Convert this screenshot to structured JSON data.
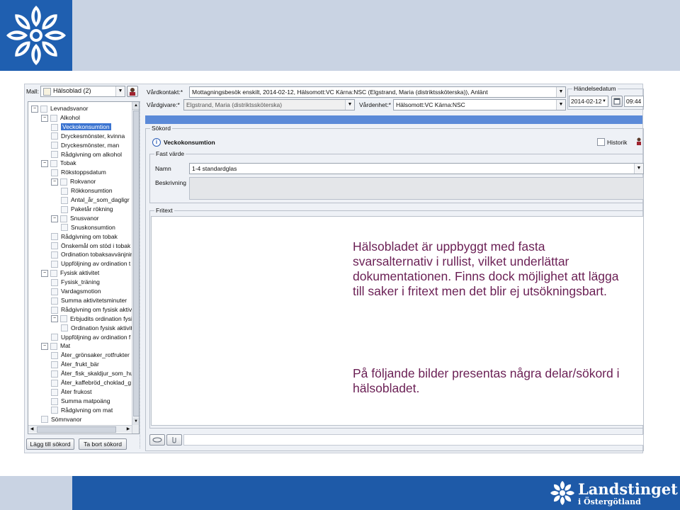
{
  "app": {
    "mall_label": "Mall:",
    "mall_value": "Hälsoblad (2)",
    "vardkontakt_label": "Vårdkontakt:*",
    "vardkontakt_value": "Mottagningsbesök enskilt, 2014-02-12, Hälsomott:VC Kärna:NSC (Elgstrand, Maria (distriktssköterska)), Anlänt",
    "vardgivare_label": "Vårdgivare:*",
    "vardgivare_value": "Elgstrand, Maria (distriktssköterska)",
    "vardenhet_label": "Vårdenhet:*",
    "vardenhet_value": "Hälsomott:VC Kärna:NSC",
    "handelsedatum_label": "Händelsedatum",
    "date_value": "2014-02-12",
    "time_value": "09:44",
    "sokord_label": "Sökord",
    "sokord_title": "Veckokonsumtion",
    "historik_label": "Historik",
    "fast_varde_label": "Fast värde",
    "namn_label": "Namn",
    "namn_value": "1-4 standardglas",
    "beskrivning_label": "Beskrivning",
    "fritext_label": "Fritext",
    "add_button": "Lägg till sökord",
    "remove_button": "Ta bort sökord"
  },
  "tree": [
    {
      "label": "Levnadsvanor",
      "level": 0,
      "type": "root"
    },
    {
      "label": "Alkohol",
      "level": 1,
      "type": "folder"
    },
    {
      "label": "Veckokonsumtion",
      "level": 2,
      "type": "leaf",
      "selected": true
    },
    {
      "label": "Dryckesmönster, kvinna",
      "level": 2,
      "type": "leaf"
    },
    {
      "label": "Dryckesmönster, man",
      "level": 2,
      "type": "leaf"
    },
    {
      "label": "Rådgivning om alkohol",
      "level": 2,
      "type": "leaf"
    },
    {
      "label": "Tobak",
      "level": 1,
      "type": "folder"
    },
    {
      "label": "Rökstoppsdatum",
      "level": 2,
      "type": "leaf"
    },
    {
      "label": "Rokvanor",
      "level": 2,
      "type": "folder"
    },
    {
      "label": "Rökkonsumtion",
      "level": 3,
      "type": "leaf"
    },
    {
      "label": "Antal_år_som_dagligr",
      "level": 3,
      "type": "leaf"
    },
    {
      "label": "Paketår rökning",
      "level": 3,
      "type": "leaf"
    },
    {
      "label": "Snusvanor",
      "level": 2,
      "type": "folder"
    },
    {
      "label": "Snuskonsumtion",
      "level": 3,
      "type": "leaf"
    },
    {
      "label": "Rådgivning om tobak",
      "level": 2,
      "type": "leaf"
    },
    {
      "label": "Önskemål om stöd i tobak",
      "level": 2,
      "type": "leaf"
    },
    {
      "label": "Ordination tobaksavvänjnin",
      "level": 2,
      "type": "leaf"
    },
    {
      "label": "Uppföljning av ordination t",
      "level": 2,
      "type": "leaf"
    },
    {
      "label": "Fysisk aktivitet",
      "level": 1,
      "type": "folder"
    },
    {
      "label": "Fysisk_träning",
      "level": 2,
      "type": "leaf"
    },
    {
      "label": "Vardagsmotion",
      "level": 2,
      "type": "leaf"
    },
    {
      "label": "Summa aktivitetsminuter",
      "level": 2,
      "type": "leaf"
    },
    {
      "label": "Rådgivning om fysisk aktiv",
      "level": 2,
      "type": "leaf"
    },
    {
      "label": "Erbjudits ordination fysisk a",
      "level": 2,
      "type": "folder"
    },
    {
      "label": "Ordination fysisk aktivit",
      "level": 3,
      "type": "leaf"
    },
    {
      "label": "Uppföljning av ordination f",
      "level": 2,
      "type": "leaf"
    },
    {
      "label": "Mat",
      "level": 1,
      "type": "folder"
    },
    {
      "label": "Äter_grönsaker_rotfrukter",
      "level": 2,
      "type": "leaf"
    },
    {
      "label": "Äter_frukt_bär",
      "level": 2,
      "type": "leaf"
    },
    {
      "label": "Äter_fisk_skaldjur_som_hu",
      "level": 2,
      "type": "leaf"
    },
    {
      "label": "Äter_kaffebröd_choklad_g",
      "level": 2,
      "type": "leaf"
    },
    {
      "label": "Äter frukost",
      "level": 2,
      "type": "leaf"
    },
    {
      "label": "Summa matpoäng",
      "level": 2,
      "type": "leaf"
    },
    {
      "label": "Rådgivning om mat",
      "level": 2,
      "type": "leaf"
    },
    {
      "label": "Sömnvanor",
      "level": 1,
      "type": "leaf"
    }
  ],
  "overlay": {
    "paragraph1": "Hälsobladet är uppbyggt med fasta svarsalternativ i rullist, vilket underlättar dokumentationen. Finns dock möjlighet att lägga till saker i fritext men det blir ej utsökningsbart.",
    "paragraph2": "På följande bilder presentas några delar/sökord i hälsobladet."
  },
  "brand": {
    "name": "Landstinget",
    "sub": "i Östergötland"
  },
  "colors": {
    "header_band": "#c9d3e3",
    "logo_blue": "#1f5fb0",
    "footer_blue": "#1e5aa8",
    "overlay_text": "#6a1f54",
    "selection": "#3b74d1"
  }
}
